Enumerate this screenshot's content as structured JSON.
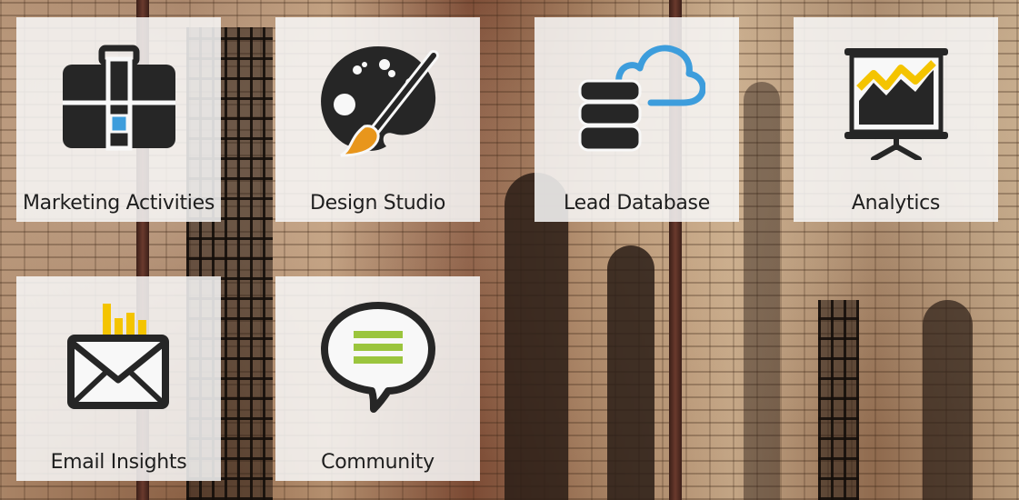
{
  "tiles": [
    {
      "id": "marketing-activities",
      "label": "Marketing Activities",
      "icon": "briefcase-icon"
    },
    {
      "id": "design-studio",
      "label": "Design Studio",
      "icon": "palette-icon"
    },
    {
      "id": "lead-database",
      "label": "Lead Database",
      "icon": "cloud-database-icon"
    },
    {
      "id": "analytics",
      "label": "Analytics",
      "icon": "presentation-chart-icon"
    },
    {
      "id": "email-insights",
      "label": "Email Insights",
      "icon": "email-chart-icon"
    },
    {
      "id": "community",
      "label": "Community",
      "icon": "speech-bubble-icon"
    }
  ],
  "colors": {
    "icon_dark": "#262626",
    "accent_blue": "#3d9ddc",
    "accent_orange": "#e8961c",
    "accent_yellow": "#f4c400",
    "accent_green": "#9bc53d",
    "tile_background": "#f8f8f8"
  }
}
